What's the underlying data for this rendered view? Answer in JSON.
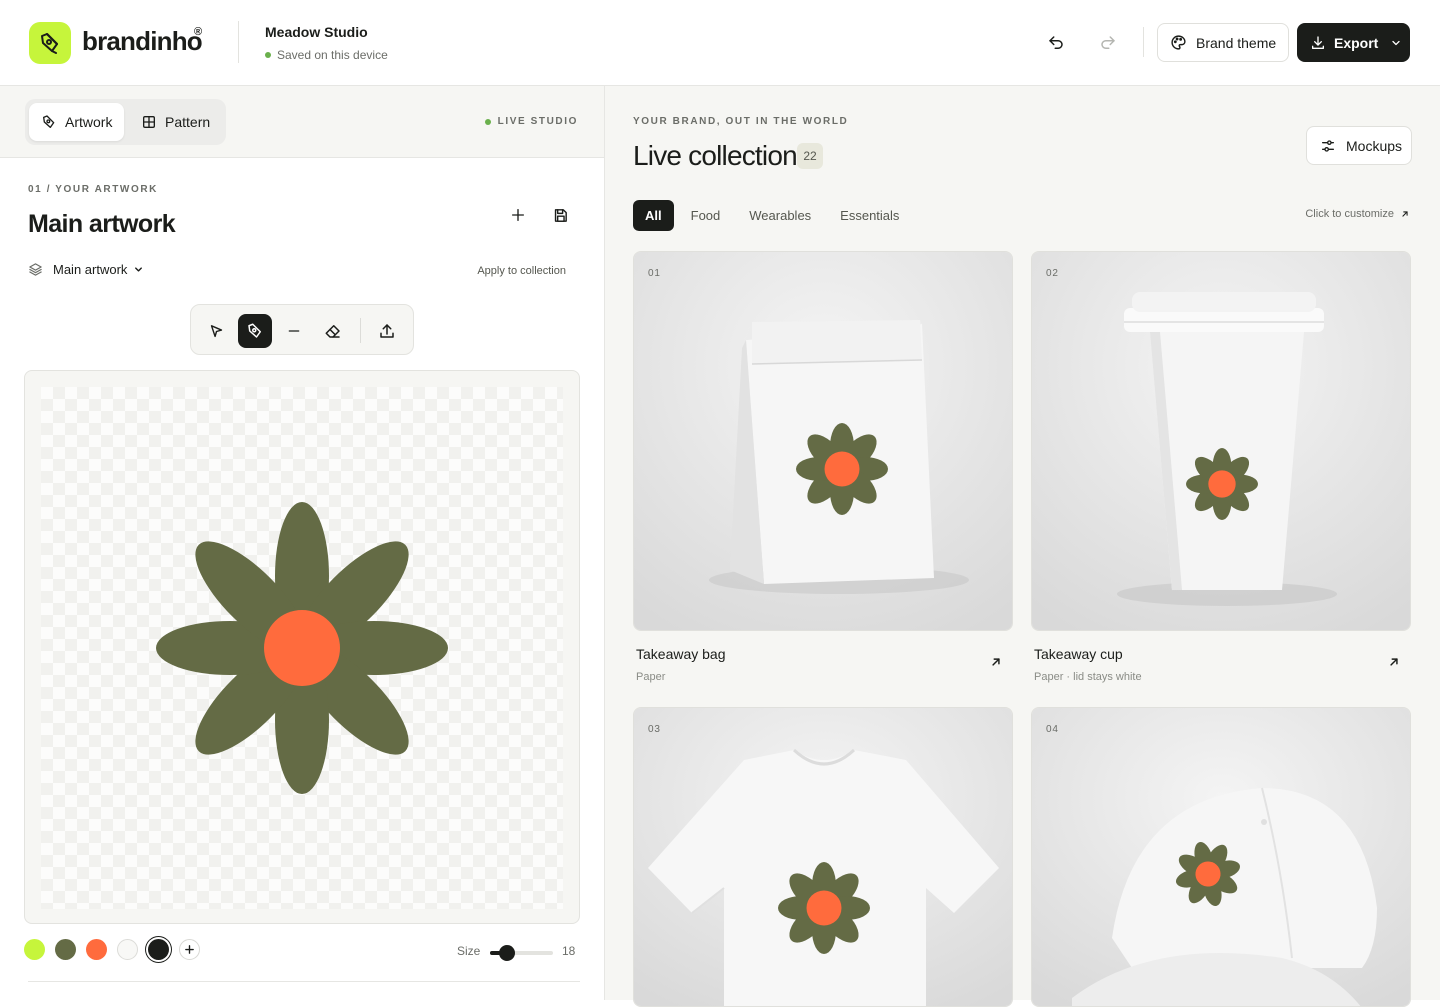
{
  "app": {
    "logo_text": "brandinho",
    "logo_reg": "®",
    "project_name": "Meadow Studio",
    "project_status": "Saved on this device"
  },
  "header": {
    "brand_theme_label": "Brand theme",
    "export_label": "Export"
  },
  "editor": {
    "tabs": [
      {
        "label": "Artwork",
        "icon": "pen-tool-icon",
        "active": true
      },
      {
        "label": "Pattern",
        "icon": "grid-icon",
        "active": false
      }
    ],
    "live_status": "LIVE STUDIO",
    "eyebrow": "01 / YOUR ARTWORK",
    "title": "Main artwork",
    "layer_select": "Main artwork",
    "apply_link": "Apply to collection",
    "tools": [
      "select-icon",
      "pen-icon",
      "line-icon",
      "eraser-icon",
      "upload-icon"
    ],
    "active_tool": "pen-icon",
    "palette": [
      "#c6f53b",
      "#646b45",
      "#ff6b3d",
      "#f8f8f6",
      "#1b1d1a"
    ],
    "selected_color": "#1b1d1a",
    "size_label": "Size",
    "size_value": "18",
    "size_fraction": 0.18
  },
  "artwork": {
    "petal_color": "#646b45",
    "center_color": "#ff6b3d"
  },
  "collection": {
    "eyebrow": "YOUR BRAND, OUT IN THE WORLD",
    "title": "Live collection",
    "count": "22",
    "mockups_label": "Mockups",
    "filters": [
      {
        "label": "All",
        "active": true
      },
      {
        "label": "Food",
        "active": false
      },
      {
        "label": "Wearables",
        "active": false
      },
      {
        "label": "Essentials",
        "active": false
      }
    ],
    "customize_hint": "Click to customize",
    "cards": [
      {
        "num": "01",
        "title": "Takeaway bag",
        "sub": "Paper"
      },
      {
        "num": "02",
        "title": "Takeaway cup",
        "sub": "Paper · lid stays white"
      },
      {
        "num": "03",
        "title": "",
        "sub": ""
      },
      {
        "num": "04",
        "title": "",
        "sub": ""
      }
    ]
  }
}
